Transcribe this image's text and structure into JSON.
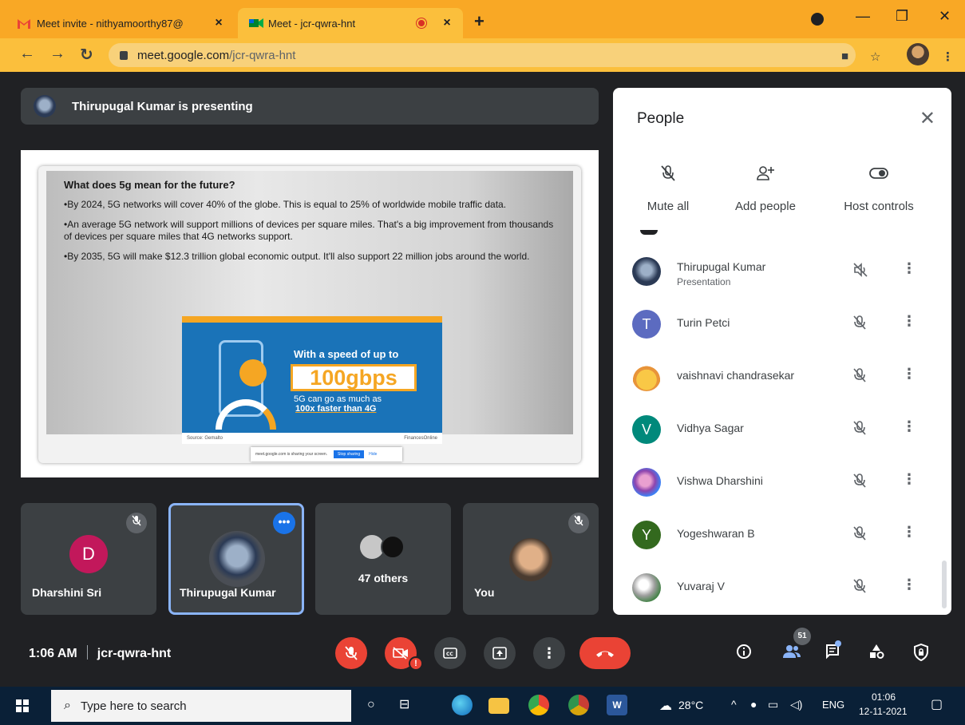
{
  "browser": {
    "tabs": [
      {
        "title": "Meet invite - nithyamoorthy87@",
        "close": "×"
      },
      {
        "title": "Meet - jcr-qwra-hnt",
        "close": "×"
      }
    ],
    "new_tab": "+",
    "url_domain": "meet.google.com",
    "url_path": "/jcr-qwra-hnt",
    "window_controls": [
      "—",
      "❐",
      "✕"
    ]
  },
  "presenting": {
    "banner": "Thirupugal Kumar is presenting"
  },
  "slide": {
    "heading": "What does 5g mean for the future?",
    "bullets": [
      "•By 2024, 5G networks will cover 40% of the globe. This is equal to 25% of worldwide mobile traffic data.",
      "•An average 5G network will support millions of devices per square miles. That's a big improvement from thousands of devices per square miles that 4G networks support.",
      "•By 2035, 5G will make $12.3 trillion global economic output. It'll also support 22 million jobs around the world."
    ],
    "infographic": {
      "line1": "With a speed of up to",
      "speed": "100gbps",
      "line2": "5G can go  as much as",
      "line3": "100x faster than 4G",
      "source": "Source: Gemalto",
      "brand": "FinancesOnline"
    },
    "sharebar": {
      "text": "meet.google.com is sharing your screen.",
      "stop": "Stop sharing",
      "hide": "Hide"
    }
  },
  "tiles": [
    {
      "name": "Dharshini Sri",
      "initial": "D",
      "avatar_color": "#c2185b"
    },
    {
      "name": "Thirupugal Kumar"
    },
    {
      "label": "47 others"
    },
    {
      "name": "You"
    }
  ],
  "people_panel": {
    "title": "People",
    "close": "✕",
    "actions": [
      {
        "label": "Mute all",
        "icon": "mic-off-icon"
      },
      {
        "label": "Add people",
        "icon": "add-person-icon"
      },
      {
        "label": "Host controls",
        "icon": "toggle-icon"
      }
    ],
    "participants": [
      {
        "name": "Thirupugal Kumar",
        "sub": "Presentation",
        "initial": "",
        "color": "#2b3a55"
      },
      {
        "name": "Turin Petci",
        "sub": "",
        "initial": "T",
        "color": "#5c6bc0"
      },
      {
        "name": "vaishnavi chandrasekar",
        "sub": "",
        "initial": "",
        "color": "#f9c846"
      },
      {
        "name": "Vidhya Sagar",
        "sub": "",
        "initial": "V",
        "color": "#00897b"
      },
      {
        "name": "Vishwa Dharshini",
        "sub": "",
        "initial": "",
        "color": "#8e44ad"
      },
      {
        "name": "Yogeshwaran B",
        "sub": "",
        "initial": "Y",
        "color": "#33691e"
      },
      {
        "name": "Yuvaraj V",
        "sub": "",
        "initial": "",
        "color": "#9e9e9e"
      }
    ]
  },
  "controls": {
    "time": "1:06 AM",
    "meeting_code": "jcr-qwra-hnt",
    "people_count": "51",
    "alert": "!"
  },
  "taskbar": {
    "search_placeholder": "Type here to search",
    "temperature": "28°C",
    "language": "ENG",
    "clock_time": "01:06",
    "clock_date": "12-11-2021"
  }
}
